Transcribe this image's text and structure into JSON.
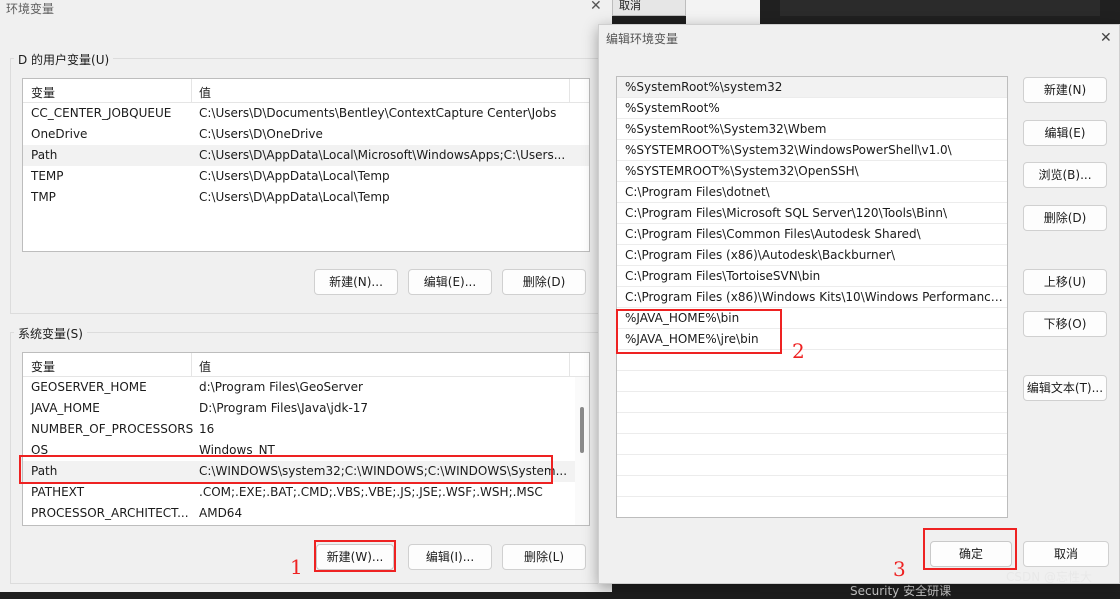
{
  "background": {
    "cancel_label": "取消",
    "bottom_text": "Security 安全研课"
  },
  "left_dialog": {
    "title": "环境变量",
    "close_glyph": "✕",
    "user_vars": {
      "group_label": "D 的用户变量(U)",
      "col_name": "变量",
      "col_value": "值",
      "rows": [
        {
          "name": "CC_CENTER_JOBQUEUE",
          "value": "C:\\Users\\D\\Documents\\Bentley\\ContextCapture Center\\Jobs"
        },
        {
          "name": "OneDrive",
          "value": "C:\\Users\\D\\OneDrive"
        },
        {
          "name": "Path",
          "value": "C:\\Users\\D\\AppData\\Local\\Microsoft\\WindowsApps;C:\\Users..."
        },
        {
          "name": "TEMP",
          "value": "C:\\Users\\D\\AppData\\Local\\Temp"
        },
        {
          "name": "TMP",
          "value": "C:\\Users\\D\\AppData\\Local\\Temp"
        }
      ],
      "new_label": "新建(N)...",
      "edit_label": "编辑(E)...",
      "delete_label": "删除(D)"
    },
    "system_vars": {
      "group_label": "系统变量(S)",
      "col_name": "变量",
      "col_value": "值",
      "rows": [
        {
          "name": "GEOSERVER_HOME",
          "value": "d:\\Program Files\\GeoServer"
        },
        {
          "name": "JAVA_HOME",
          "value": "D:\\Program Files\\Java\\jdk-17"
        },
        {
          "name": "NUMBER_OF_PROCESSORS",
          "value": "16"
        },
        {
          "name": "OS",
          "value": "Windows_NT"
        },
        {
          "name": "Path",
          "value": "C:\\WINDOWS\\system32;C:\\WINDOWS;C:\\WINDOWS\\System..."
        },
        {
          "name": "PATHEXT",
          "value": ".COM;.EXE;.BAT;.CMD;.VBS;.VBE;.JS;.JSE;.WSF;.WSH;.MSC"
        },
        {
          "name": "PROCESSOR_ARCHITECT...",
          "value": "AMD64"
        }
      ],
      "new_label": "新建(W)...",
      "edit_label": "编辑(I)...",
      "delete_label": "删除(L)"
    }
  },
  "right_dialog": {
    "title": "编辑环境变量",
    "close_glyph": "✕",
    "paths": [
      "%SystemRoot%\\system32",
      "%SystemRoot%",
      "%SystemRoot%\\System32\\Wbem",
      "%SYSTEMROOT%\\System32\\WindowsPowerShell\\v1.0\\",
      "%SYSTEMROOT%\\System32\\OpenSSH\\",
      "C:\\Program Files\\dotnet\\",
      "C:\\Program Files\\Microsoft SQL Server\\120\\Tools\\Binn\\",
      "C:\\Program Files\\Common Files\\Autodesk Shared\\",
      "C:\\Program Files (x86)\\Autodesk\\Backburner\\",
      "C:\\Program Files\\TortoiseSVN\\bin",
      "C:\\Program Files (x86)\\Windows Kits\\10\\Windows Performance ...",
      "%JAVA_HOME%\\bin",
      "%JAVA_HOME%\\jre\\bin"
    ],
    "buttons": {
      "new": "新建(N)",
      "edit": "编辑(E)",
      "browse": "浏览(B)...",
      "delete": "删除(D)",
      "move_up": "上移(U)",
      "move_down": "下移(O)",
      "edit_text": "编辑文本(T)...",
      "ok": "确定",
      "cancel": "取消"
    }
  },
  "annotations": {
    "step1": "1",
    "step2": "2",
    "step3": "3",
    "color": "#e22222"
  },
  "watermark": "CSDN @忘性大"
}
